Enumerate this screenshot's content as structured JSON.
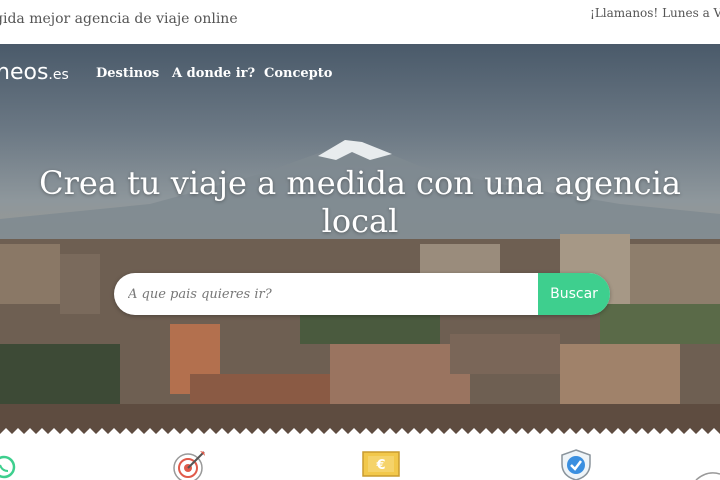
{
  "topbar": {
    "tagline": "gida mejor agencia de viaje online",
    "phone": "¡Llamanos! Lunes a Vie"
  },
  "logo": {
    "text": "neos",
    "suffix": ".es"
  },
  "nav": [
    {
      "label": "Destinos"
    },
    {
      "label": "A donde ir?"
    },
    {
      "label": "Concepto"
    }
  ],
  "hero": {
    "headline_line1": "Crea tu viaje a medida con una agencia",
    "headline_line2": "local"
  },
  "search": {
    "placeholder": "A que pais quieres ir?",
    "button_label": "Buscar"
  },
  "features": [
    {
      "icon": "whatsapp-icon"
    },
    {
      "icon": "target-icon"
    },
    {
      "icon": "euro-money-icon"
    },
    {
      "icon": "shield-check-icon"
    }
  ],
  "colors": {
    "accent": "#3ecf8e",
    "text": "#555555"
  }
}
